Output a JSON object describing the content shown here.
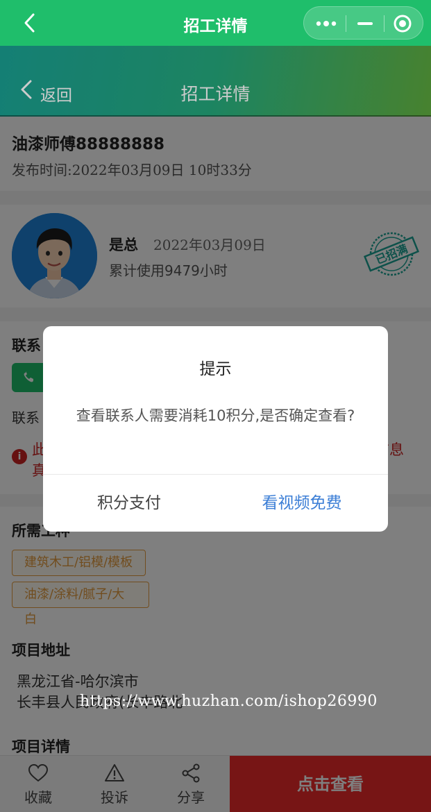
{
  "wx_bar": {
    "title": "招工详情",
    "icons": [
      "back-icon",
      "more-icon",
      "minimize-icon",
      "target-icon"
    ]
  },
  "header": {
    "back_label": "返回",
    "title": "招工详情"
  },
  "job": {
    "title": "油漆师傅88888888",
    "publish_time": "发布时间:2022年03月09日 10时33分"
  },
  "employer": {
    "name": "是总",
    "date": "2022年03月09日",
    "usage": "累计使用9479小时",
    "stamp": "已招满"
  },
  "contact": {
    "label": "联系",
    "line": "联系",
    "warning_line1": "此",
    "warning_line2": "真",
    "warning_tail": "信息"
  },
  "requirements": {
    "label": "所需工种",
    "tags": [
      "建筑木工/铝模/模板",
      "油漆/涂料/腻子/大白"
    ]
  },
  "address": {
    "label": "项目地址",
    "line1": "黑龙江省-哈尔滨市",
    "line2": "长丰县人民政府(长丰路北",
    "watermark": "https://www.huzhan.com/ishop26990"
  },
  "details": {
    "label": "项目详情"
  },
  "bottom_bar": {
    "favorite": "收藏",
    "report": "投诉",
    "share": "分享",
    "view": "点击查看"
  },
  "modal": {
    "title": "提示",
    "message": "查看联系人需要消耗10积分,是否确定查看?",
    "pay_button": "积分支付",
    "video_button": "看视频免费"
  },
  "colors": {
    "wx_green": "#1fbe6b",
    "danger_red": "#ef2b2b",
    "link_blue": "#3b7ed6",
    "tag_orange": "#e39a3c"
  }
}
